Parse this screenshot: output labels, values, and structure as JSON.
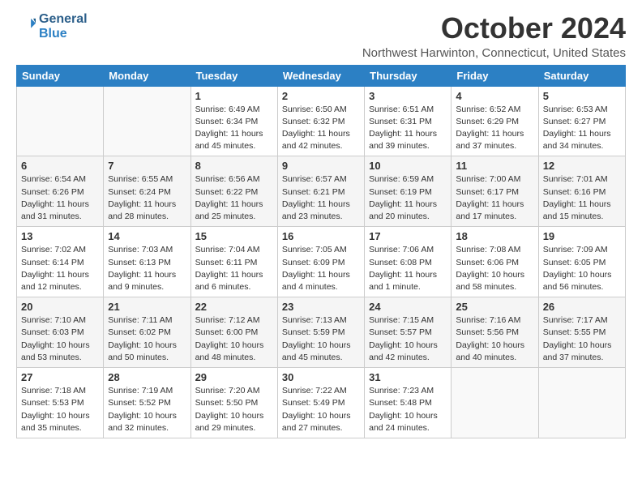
{
  "header": {
    "logo_line1": "General",
    "logo_line2": "Blue",
    "title": "October 2024",
    "location": "Northwest Harwinton, Connecticut, United States"
  },
  "weekdays": [
    "Sunday",
    "Monday",
    "Tuesday",
    "Wednesday",
    "Thursday",
    "Friday",
    "Saturday"
  ],
  "weeks": [
    [
      {
        "day": "",
        "info": ""
      },
      {
        "day": "",
        "info": ""
      },
      {
        "day": "1",
        "info": "Sunrise: 6:49 AM\nSunset: 6:34 PM\nDaylight: 11 hours and 45 minutes."
      },
      {
        "day": "2",
        "info": "Sunrise: 6:50 AM\nSunset: 6:32 PM\nDaylight: 11 hours and 42 minutes."
      },
      {
        "day": "3",
        "info": "Sunrise: 6:51 AM\nSunset: 6:31 PM\nDaylight: 11 hours and 39 minutes."
      },
      {
        "day": "4",
        "info": "Sunrise: 6:52 AM\nSunset: 6:29 PM\nDaylight: 11 hours and 37 minutes."
      },
      {
        "day": "5",
        "info": "Sunrise: 6:53 AM\nSunset: 6:27 PM\nDaylight: 11 hours and 34 minutes."
      }
    ],
    [
      {
        "day": "6",
        "info": "Sunrise: 6:54 AM\nSunset: 6:26 PM\nDaylight: 11 hours and 31 minutes."
      },
      {
        "day": "7",
        "info": "Sunrise: 6:55 AM\nSunset: 6:24 PM\nDaylight: 11 hours and 28 minutes."
      },
      {
        "day": "8",
        "info": "Sunrise: 6:56 AM\nSunset: 6:22 PM\nDaylight: 11 hours and 25 minutes."
      },
      {
        "day": "9",
        "info": "Sunrise: 6:57 AM\nSunset: 6:21 PM\nDaylight: 11 hours and 23 minutes."
      },
      {
        "day": "10",
        "info": "Sunrise: 6:59 AM\nSunset: 6:19 PM\nDaylight: 11 hours and 20 minutes."
      },
      {
        "day": "11",
        "info": "Sunrise: 7:00 AM\nSunset: 6:17 PM\nDaylight: 11 hours and 17 minutes."
      },
      {
        "day": "12",
        "info": "Sunrise: 7:01 AM\nSunset: 6:16 PM\nDaylight: 11 hours and 15 minutes."
      }
    ],
    [
      {
        "day": "13",
        "info": "Sunrise: 7:02 AM\nSunset: 6:14 PM\nDaylight: 11 hours and 12 minutes."
      },
      {
        "day": "14",
        "info": "Sunrise: 7:03 AM\nSunset: 6:13 PM\nDaylight: 11 hours and 9 minutes."
      },
      {
        "day": "15",
        "info": "Sunrise: 7:04 AM\nSunset: 6:11 PM\nDaylight: 11 hours and 6 minutes."
      },
      {
        "day": "16",
        "info": "Sunrise: 7:05 AM\nSunset: 6:09 PM\nDaylight: 11 hours and 4 minutes."
      },
      {
        "day": "17",
        "info": "Sunrise: 7:06 AM\nSunset: 6:08 PM\nDaylight: 11 hours and 1 minute."
      },
      {
        "day": "18",
        "info": "Sunrise: 7:08 AM\nSunset: 6:06 PM\nDaylight: 10 hours and 58 minutes."
      },
      {
        "day": "19",
        "info": "Sunrise: 7:09 AM\nSunset: 6:05 PM\nDaylight: 10 hours and 56 minutes."
      }
    ],
    [
      {
        "day": "20",
        "info": "Sunrise: 7:10 AM\nSunset: 6:03 PM\nDaylight: 10 hours and 53 minutes."
      },
      {
        "day": "21",
        "info": "Sunrise: 7:11 AM\nSunset: 6:02 PM\nDaylight: 10 hours and 50 minutes."
      },
      {
        "day": "22",
        "info": "Sunrise: 7:12 AM\nSunset: 6:00 PM\nDaylight: 10 hours and 48 minutes."
      },
      {
        "day": "23",
        "info": "Sunrise: 7:13 AM\nSunset: 5:59 PM\nDaylight: 10 hours and 45 minutes."
      },
      {
        "day": "24",
        "info": "Sunrise: 7:15 AM\nSunset: 5:57 PM\nDaylight: 10 hours and 42 minutes."
      },
      {
        "day": "25",
        "info": "Sunrise: 7:16 AM\nSunset: 5:56 PM\nDaylight: 10 hours and 40 minutes."
      },
      {
        "day": "26",
        "info": "Sunrise: 7:17 AM\nSunset: 5:55 PM\nDaylight: 10 hours and 37 minutes."
      }
    ],
    [
      {
        "day": "27",
        "info": "Sunrise: 7:18 AM\nSunset: 5:53 PM\nDaylight: 10 hours and 35 minutes."
      },
      {
        "day": "28",
        "info": "Sunrise: 7:19 AM\nSunset: 5:52 PM\nDaylight: 10 hours and 32 minutes."
      },
      {
        "day": "29",
        "info": "Sunrise: 7:20 AM\nSunset: 5:50 PM\nDaylight: 10 hours and 29 minutes."
      },
      {
        "day": "30",
        "info": "Sunrise: 7:22 AM\nSunset: 5:49 PM\nDaylight: 10 hours and 27 minutes."
      },
      {
        "day": "31",
        "info": "Sunrise: 7:23 AM\nSunset: 5:48 PM\nDaylight: 10 hours and 24 minutes."
      },
      {
        "day": "",
        "info": ""
      },
      {
        "day": "",
        "info": ""
      }
    ]
  ]
}
